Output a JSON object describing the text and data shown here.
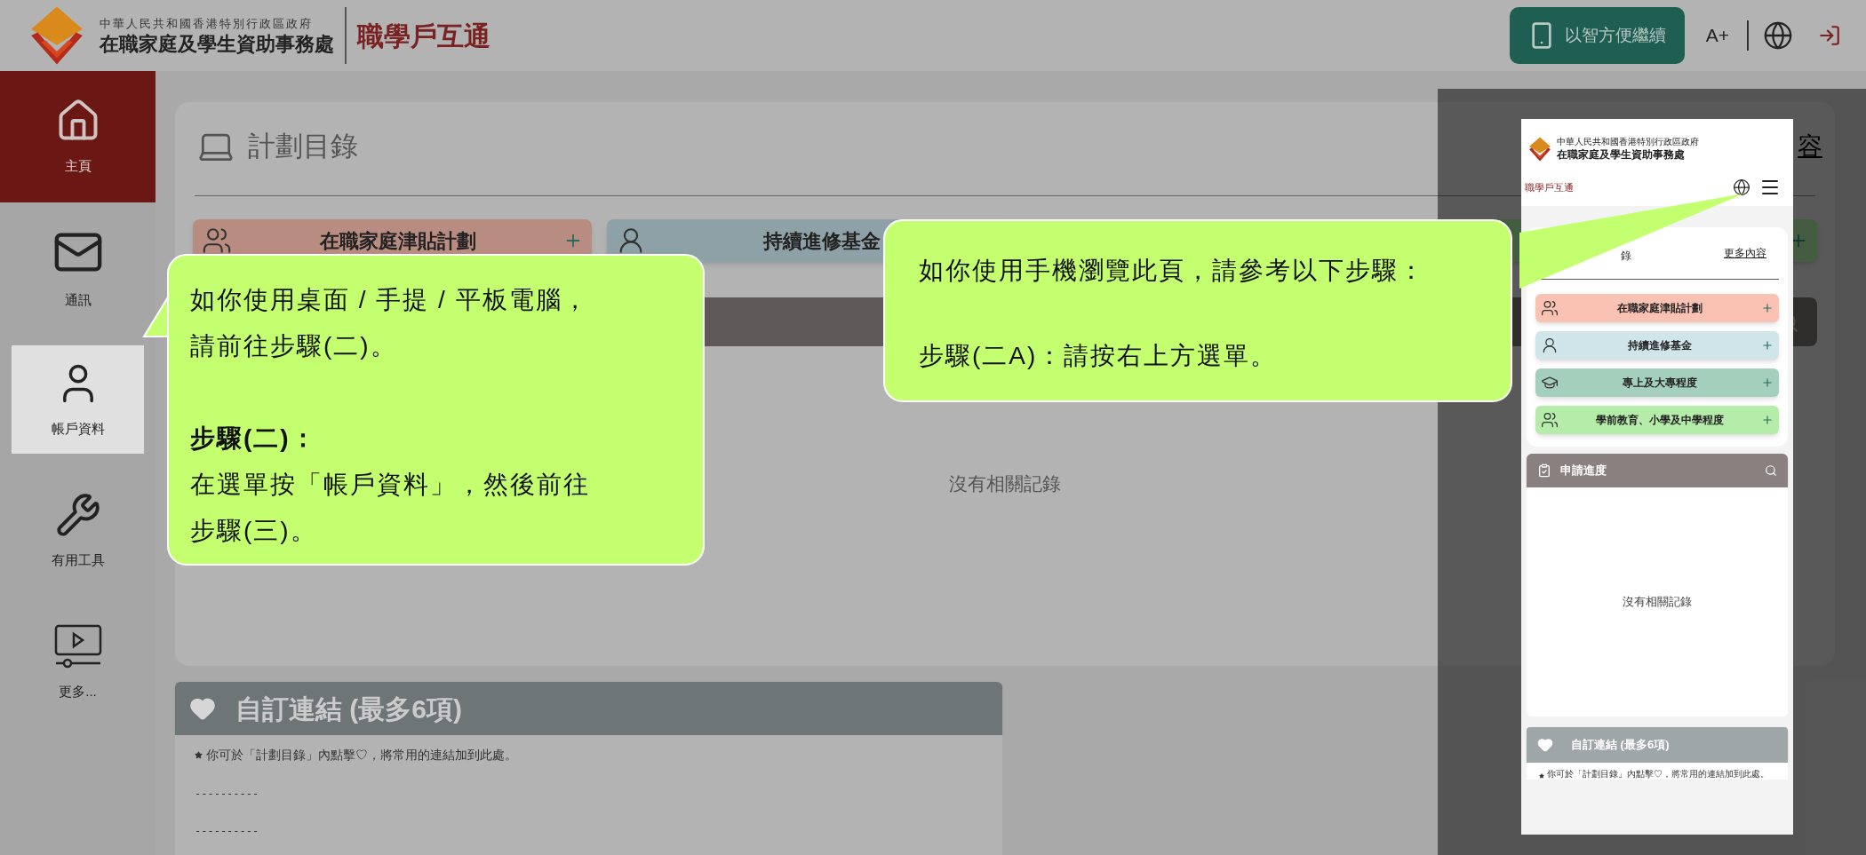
{
  "header": {
    "org_line1": "中華人民共和國香港特別行政區政府",
    "org_line2": "在職家庭及學生資助事務處",
    "app_name": "職學戶互通",
    "continue_button": "以智方便繼續",
    "font_size_button": "A+"
  },
  "sidebar": {
    "items": [
      {
        "label": "主頁",
        "selected": true,
        "highlighted": false
      },
      {
        "label": "通訊",
        "selected": false,
        "highlighted": false
      },
      {
        "label": "帳戶資料",
        "selected": false,
        "highlighted": true
      },
      {
        "label": "有用工具",
        "selected": false,
        "highlighted": false
      },
      {
        "label": "更多...",
        "selected": false,
        "highlighted": false
      }
    ]
  },
  "plan_catalog": {
    "title": "計劃目錄",
    "more_link": "容",
    "schemes": [
      {
        "label": "在職家庭津貼計劃",
        "color": "#b98c82"
      },
      {
        "label": "持續進修基金",
        "color": "#8ea1a6"
      },
      {
        "color": "#445d40"
      }
    ],
    "empty_text": "沒有相關記錄"
  },
  "favorites": {
    "title": "自訂連結 (最多6項)",
    "note": "你可於「計劃目錄」內點擊♡，將常用的連結加到此處。",
    "items": [
      "----------",
      "----------"
    ]
  },
  "phone": {
    "org_line1": "中華人民共和國香港特別行政區政府",
    "org_line2": "在職家庭及學生資助事務處",
    "app_name": "職學戶互通",
    "tabs": [
      {
        "label": "錄",
        "selected": true
      },
      {
        "label": "更多內容",
        "selected": false
      }
    ],
    "schemes": [
      {
        "label": "在職家庭津貼計劃",
        "color": "#f9c2b3"
      },
      {
        "label": "持續進修基金",
        "color": "#cfe5ea"
      },
      {
        "label": "專上及大專程度",
        "color": "#a4cfbd"
      },
      {
        "label": "學前教育、小學及中學程度",
        "color": "#b5ecaa"
      }
    ],
    "progress_title": "申請進度",
    "empty_text": "沒有相關記錄",
    "favorites_title": "自訂連結 (最多6項)",
    "note": "你可於「計劃目錄」內點擊♡，將常用的連結加到此處。"
  },
  "callouts": [
    {
      "paragraphs": [
        {
          "text": "如你使用桌面 / 手提 / 平板電腦，請前往步驟(二)。",
          "bold": false
        },
        {
          "text": "步驟(二)：",
          "bold": true
        },
        {
          "text": "在選單按「帳戶資料」，然後前往步驟(三)。",
          "bold": false
        }
      ]
    },
    {
      "paragraphs": [
        {
          "text": "如你使用手機瀏覽此頁，請參考以下步驟：",
          "bold": false
        },
        {
          "text": "步驟(二A)：請按右上方選單。",
          "bold": false
        }
      ]
    }
  ]
}
